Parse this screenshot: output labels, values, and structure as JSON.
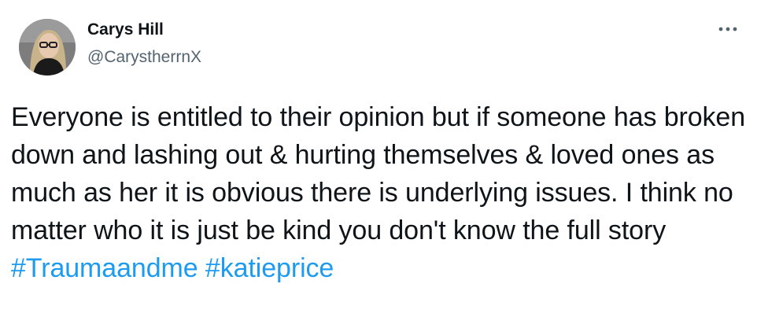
{
  "author": {
    "name": "Carys Hill",
    "handle": "@CarystherrnX"
  },
  "icons": {
    "more": "more-horizontal-icon",
    "avatar": "profile-photo"
  },
  "tweet": {
    "text": "Everyone is entitled to their opinion but if someone has broken down and lashing out & hurting themselves & loved ones as much as her it is obvious there is underlying issues. I think no matter who it is just be kind  you don't know the full story ",
    "hashtags": [
      "#Traumaandme",
      "#katieprice"
    ]
  },
  "colors": {
    "link": "#1d9bf0",
    "text": "#0f1419",
    "secondary": "#536471"
  }
}
